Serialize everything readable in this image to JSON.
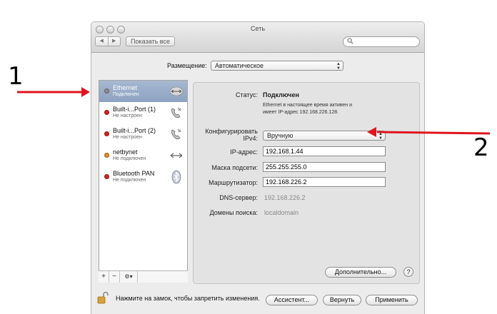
{
  "annotations": {
    "one": "1",
    "two": "2"
  },
  "window": {
    "title": "Сеть",
    "show_all_label": "Показать все"
  },
  "location": {
    "label": "Размещение:",
    "value": "Автоматическое"
  },
  "services": [
    {
      "name": "Ethernet",
      "status": "Подключен",
      "dot_color": "#8c8c8c",
      "icon": "ethernet-arrows-icon"
    },
    {
      "name": "Built-i...Port (1)",
      "status": "Не настроен",
      "dot_color": "#d52020",
      "icon": "phone-icon"
    },
    {
      "name": "Built-i...Port (2)",
      "status": "Не настроен",
      "dot_color": "#d52020",
      "icon": "phone-icon"
    },
    {
      "name": "netbynet",
      "status": "Не подключен",
      "dot_color": "#e08a2a",
      "icon": "vpn-arrows-icon"
    },
    {
      "name": "Bluetooth PAN",
      "status": "Не подключен",
      "dot_color": "#d52020",
      "icon": "bluetooth-icon"
    }
  ],
  "sidebar_tools": {
    "add": "+",
    "remove": "−",
    "action": "⚙▾"
  },
  "detail": {
    "status_label": "Статус:",
    "status_value": "Подключен",
    "status_desc_line1": "Ethernet в настоящее время активен и",
    "status_desc_line2": "имеет IP-адрес 192.168.226.128.",
    "configure_label_line1": "Конфигурировать",
    "configure_label_line2": "IPv4:",
    "configure_value": "Вручную",
    "ip_label": "IP-адрес:",
    "ip_value": "192.168.1.44",
    "mask_label": "Маска подсети:",
    "mask_value": "255.255.255.0",
    "router_label": "Маршрутизатор:",
    "router_value": "192.168.226.2",
    "dns_label": "DNS-сервер:",
    "dns_value": "192.168.226.2",
    "search_domains_label": "Домены поиска:",
    "search_domains_value": "localdomain",
    "advanced_button": "Дополнительно...",
    "help_button": "?"
  },
  "footer": {
    "lock_text": "Нажмите на замок, чтобы запретить изменения.",
    "assistant_button": "Ассистент...",
    "revert_button": "Вернуть",
    "apply_button": "Применить"
  },
  "colors": {
    "annotation_arrow": "#e0141e",
    "selected_row": "#98acc8"
  }
}
